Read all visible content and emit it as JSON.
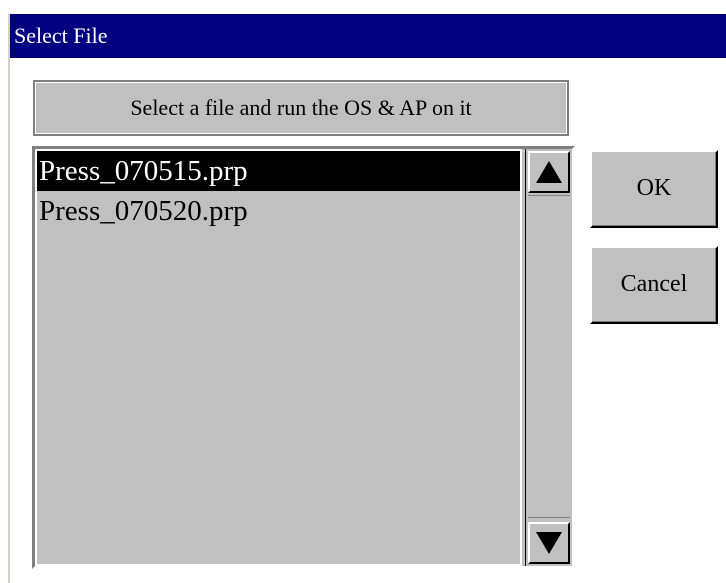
{
  "window": {
    "title": "Select File"
  },
  "instruction": "Select a file and run the OS & AP on it",
  "file_list": {
    "items": [
      {
        "label": "Press_070515.prp",
        "selected": true
      },
      {
        "label": "Press_070520.prp",
        "selected": false
      }
    ]
  },
  "scrollbar": {
    "up_icon": "triangle-up-icon",
    "down_icon": "triangle-down-icon"
  },
  "buttons": {
    "ok_label": "OK",
    "cancel_label": "Cancel"
  },
  "colors": {
    "titlebar": "#000080",
    "face": "#c0c0c0",
    "selection": "#000000"
  }
}
